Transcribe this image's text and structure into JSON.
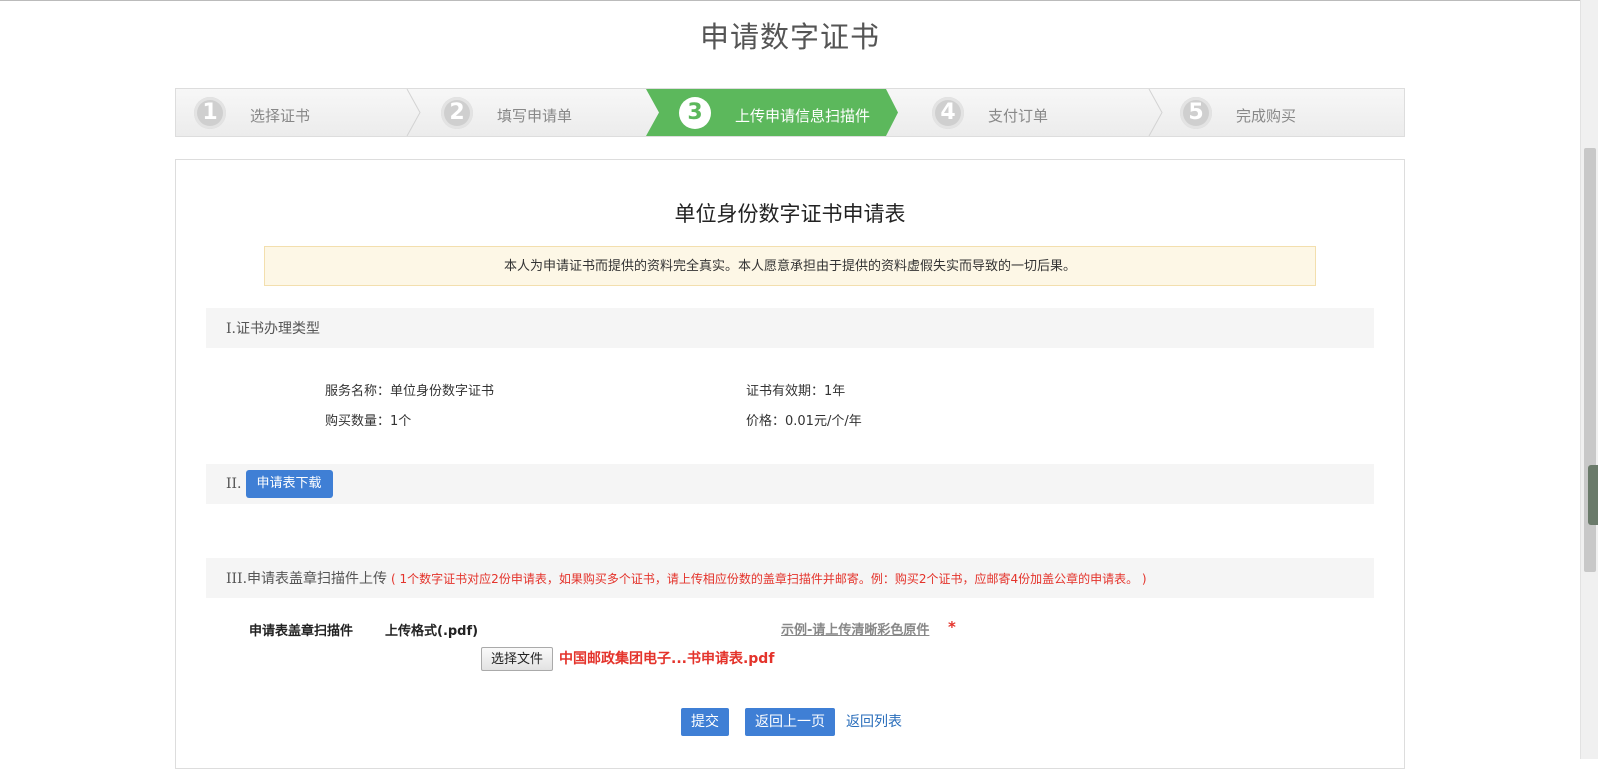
{
  "page": {
    "title": "申请数字证书"
  },
  "steps": [
    {
      "num": "1",
      "label": "选择证书"
    },
    {
      "num": "2",
      "label": "填写申请单"
    },
    {
      "num": "3",
      "label": "上传申请信息扫描件"
    },
    {
      "num": "4",
      "label": "支付订单"
    },
    {
      "num": "5",
      "label": "完成购买"
    }
  ],
  "steps_active": 3,
  "form": {
    "title": "单位身份数字证书申请表",
    "notice": "本人为申请证书而提供的资料完全真实。本人愿意承担由于提供的资料虚假失实而导致的一切后果。",
    "section1": {
      "heading": "I.证书办理类型",
      "service_name": "服务名称：单位身份数字证书",
      "validity": "证书有效期：1年",
      "quantity": "购买数量：1个",
      "price": "价格：0.01元/个/年"
    },
    "section2": {
      "prefix": "II.",
      "download_label": "申请表下载"
    },
    "section3": {
      "heading": "III.申请表盖章扫描件上传",
      "note": "( 1个数字证书对应2份申请表，如果购买多个证书，请上传相应份数的盖章扫描件并邮寄。例：购买2个证书，应邮寄4份加盖公章的申请表。 )",
      "field_label": "申请表盖章扫描件",
      "format": "上传格式(.pdf)",
      "choose_file": "选择文件",
      "file_name": "中国邮政集团电子...书申请表.pdf",
      "example": "示例-请上传清晰彩色原件",
      "required_mark": "*"
    },
    "actions": {
      "submit": "提交",
      "back": "返回上一页",
      "return_list": "返回列表"
    }
  },
  "colors": {
    "accent": "#3f7fd5",
    "active_step": "#5cb85c",
    "warning_text": "#e4332b"
  }
}
